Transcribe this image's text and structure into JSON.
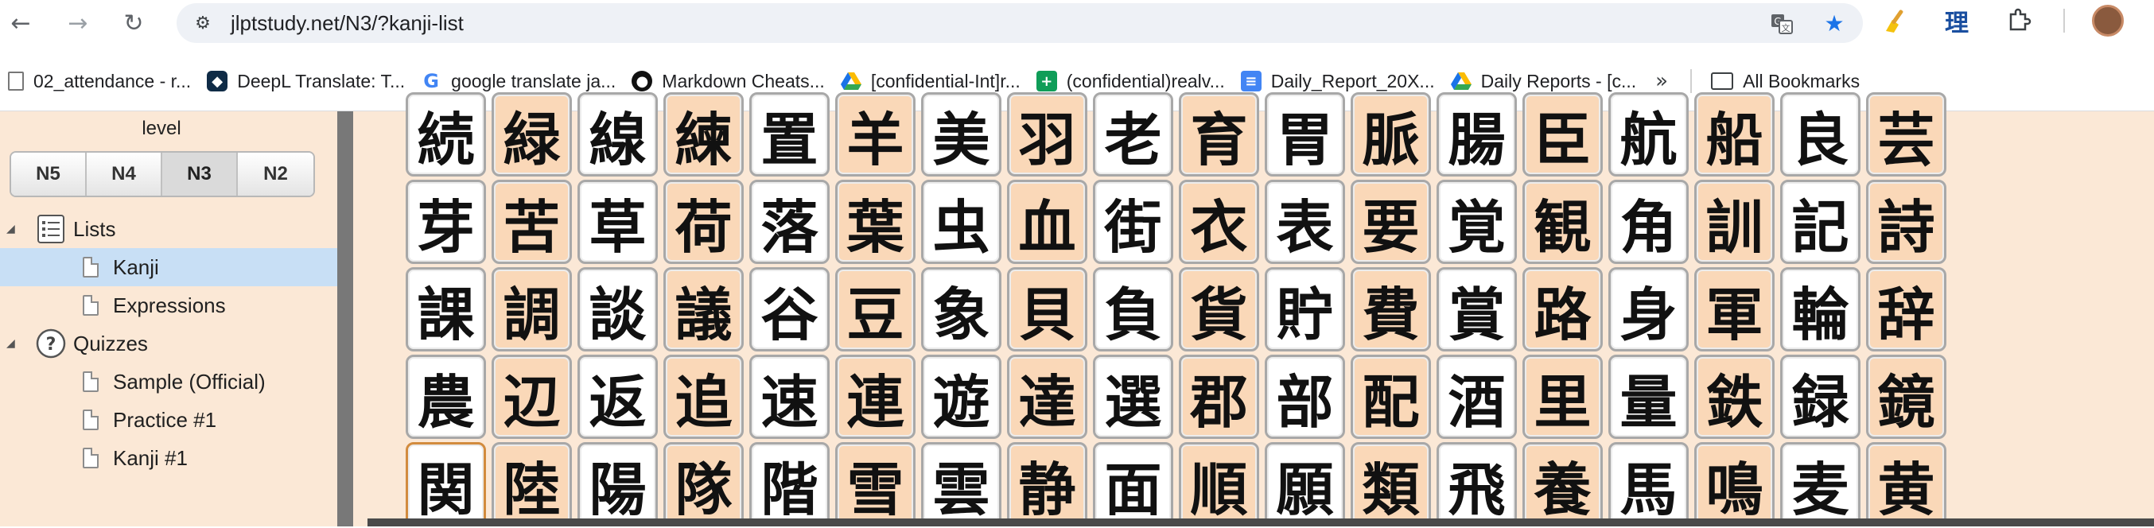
{
  "browser": {
    "url": "jlptstudy.net/N3/?kanji-list",
    "bookmarks": [
      {
        "label": "02_attendance - r...",
        "icon": "doc-icon"
      },
      {
        "label": "DeepL Translate: T...",
        "icon": "deepl-icon"
      },
      {
        "label": "google translate ja...",
        "icon": "google-icon"
      },
      {
        "label": "Markdown Cheats...",
        "icon": "github-icon"
      },
      {
        "label": "[confidential-Int]r...",
        "icon": "drive-icon"
      },
      {
        "label": "(confidential)realv...",
        "icon": "sheets-icon"
      },
      {
        "label": "Daily_Report_20X...",
        "icon": "docs-icon"
      },
      {
        "label": "Daily Reports - [c...",
        "icon": "drive-icon"
      }
    ],
    "all_bookmarks": "All Bookmarks",
    "extension_kanji": "理"
  },
  "sidebar": {
    "level_label": "level",
    "levels": [
      "N5",
      "N4",
      "N3",
      "N2"
    ],
    "active_level": "N3",
    "tree": {
      "lists_label": "Lists",
      "lists_items": [
        "Kanji",
        "Expressions"
      ],
      "quizzes_label": "Quizzes",
      "quizzes_items": [
        "Sample (Official)",
        "Practice #1",
        "Kanji #1"
      ]
    }
  },
  "kanji_rows": [
    [
      "続",
      "緑",
      "線",
      "練",
      "置",
      "羊",
      "美",
      "羽",
      "老",
      "育",
      "胃",
      "脈",
      "腸",
      "臣",
      "航",
      "船",
      "良",
      "芸"
    ],
    [
      "芽",
      "苦",
      "草",
      "荷",
      "落",
      "葉",
      "虫",
      "血",
      "街",
      "衣",
      "表",
      "要",
      "覚",
      "観",
      "角",
      "訓",
      "記",
      "詩"
    ],
    [
      "課",
      "調",
      "談",
      "議",
      "谷",
      "豆",
      "象",
      "貝",
      "負",
      "貨",
      "貯",
      "費",
      "賞",
      "路",
      "身",
      "軍",
      "輪",
      "辞"
    ],
    [
      "農",
      "辺",
      "返",
      "追",
      "速",
      "連",
      "遊",
      "達",
      "選",
      "郡",
      "部",
      "配",
      "酒",
      "里",
      "量",
      "鉄",
      "録",
      "鏡"
    ],
    [
      "関",
      "陸",
      "陽",
      "隊",
      "階",
      "雪",
      "雲",
      "静",
      "面",
      "順",
      "願",
      "類",
      "飛",
      "養",
      "馬",
      "鳴",
      "麦",
      "黄"
    ]
  ],
  "highlight_colors": {
    "card": "#ffffff",
    "alt_card": "#fad8b8",
    "background": "#fbe8d6",
    "selected": "#c8dff5"
  }
}
